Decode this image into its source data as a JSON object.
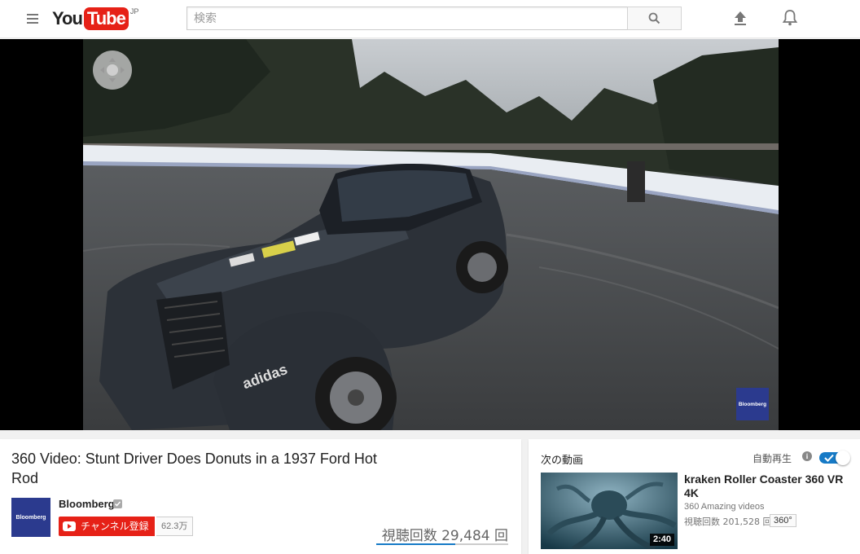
{
  "masthead": {
    "logo_you": "You",
    "logo_tube": "Tube",
    "logo_region": "JP",
    "search_placeholder": "検索"
  },
  "player": {
    "watermark": "Bloomberg"
  },
  "video": {
    "title": "360 Video: Stunt Driver Does Donuts in a 1937 Ford Hot Rod",
    "channel_name": "Bloomberg",
    "channel_avatar_text": "Bloomberg",
    "subscribe_label": "チャンネル登録",
    "subscriber_count": "62.3万",
    "view_count": "視聴回数 29,484 回",
    "like_ratio": 0.6
  },
  "up_next": {
    "header": "次の動画",
    "autoplay_label": "自動再生",
    "autoplay_on": true,
    "items": [
      {
        "title": "kraken Roller Coaster 360 VR 4K",
        "channel": "360 Amazing videos",
        "views": "視聴回数 201,528 回",
        "badge": "360°",
        "duration": "2:40"
      }
    ]
  },
  "colors": {
    "brand_red": "#e62117",
    "accent_blue": "#167ac6",
    "bloomberg_blue": "#2b3a8e"
  },
  "icons": [
    "menu-icon",
    "search-icon",
    "upload-icon",
    "bell-icon",
    "pan-control-icon",
    "verified-icon",
    "info-icon",
    "check-icon"
  ]
}
